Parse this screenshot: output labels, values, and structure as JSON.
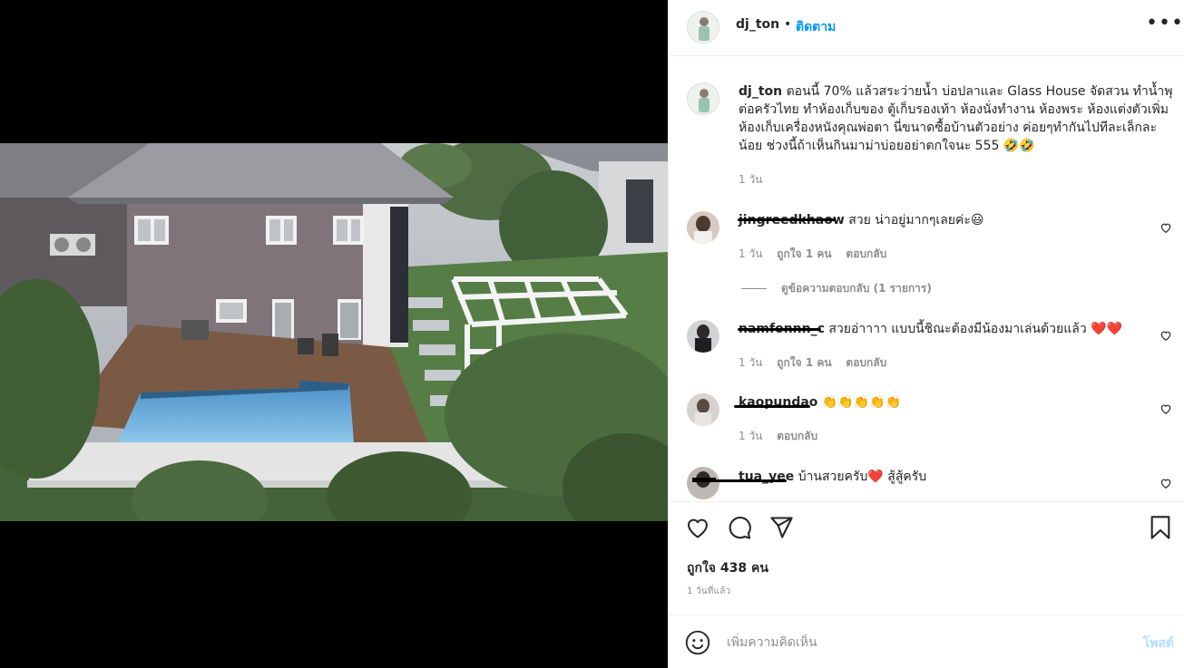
{
  "post": {
    "username": "dj_ton",
    "follow_label": "ติดตาม",
    "separator": "•",
    "more_icon": "more-horizontal-icon",
    "caption": "ตอนนี้ 70% แล้วสระว่ายน้ำ บ่อปลาและ Glass House จัดสวน ทำน้ำพุ ต่อครัวไทย ทำห้องเก็บของ ตู้เก็บรองเท้า ห้องนั่งทำงาน ห้องพระ ห้องแต่งตัวเพิ่ม ห้องเก็บเครื่องหนังคุณพ่อตา นี่ขนาดซื้อบ้านตัวอย่าง ค่อยๆทำกันไปทีละเล็กละน้อย ช่วงนี้ถ้าเห็นกินมาม่าบ่อยอย่าตกใจนะ 555 🤣🤣",
    "caption_time": "1 วัน"
  },
  "comments": [
    {
      "username": "jingreedkhaow",
      "text": "สวย น่าอยู่มากๆเลยค่ะ😃",
      "time": "1 วัน",
      "likes": "ถูกใจ 1 คน",
      "reply": "ตอบกลับ",
      "view_replies": "ดูข้อความตอบกลับ (1 รายการ)"
    },
    {
      "username": "namfonnn_c",
      "text": "สวยอ่าาาา แบบนี้ชิณะต้องมีน้องมาเล่นด้วยแล้ว ❤️❤️",
      "time": "1 วัน",
      "likes": "ถูกใจ 1 คน",
      "reply": "ตอบกลับ"
    },
    {
      "username": "kaopundao",
      "text": "👏👏👏👏👏",
      "time": "1 วัน",
      "reply": "ตอบกลับ"
    },
    {
      "username": "tua_yee",
      "text": "บ้านสวยครับ❤️ สู้สู้ครับ"
    }
  ],
  "actions": {
    "icons": [
      "heart-icon",
      "comment-icon",
      "share-icon",
      "bookmark-icon"
    ],
    "likes": "ถูกใจ 438 คน",
    "posted": "1 วันที่แล้ว"
  },
  "add_comment": {
    "placeholder": "เพิ่มความคิดเห็น",
    "post_label": "โพสต์",
    "emoji_icon": "emoji-icon"
  },
  "colors": {
    "accent": "#0095f6",
    "post_disabled": "#b2dffc",
    "muted": "#8e8e8e",
    "like_red": "#ed4956"
  }
}
